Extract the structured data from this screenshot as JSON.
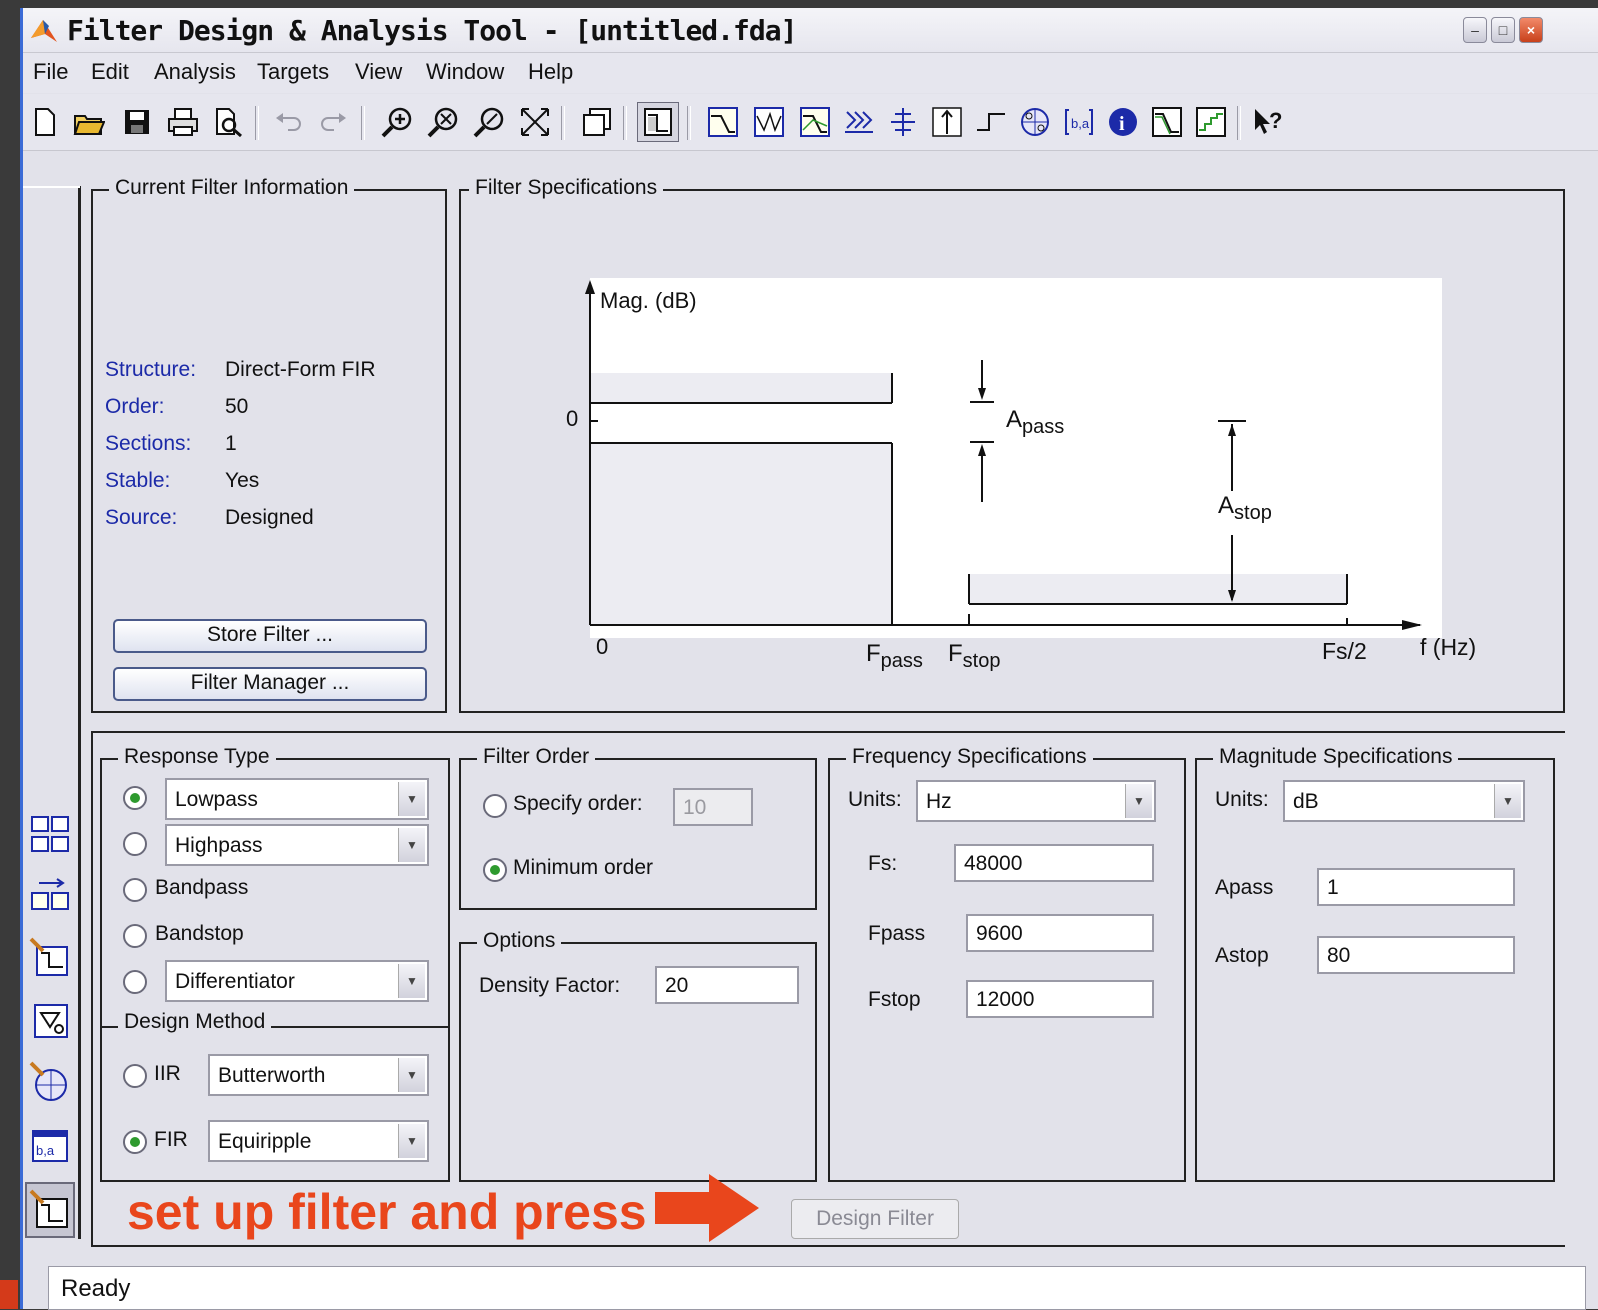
{
  "window": {
    "title": "Filter Design & Analysis Tool - [untitled.fda]",
    "minimize_label": "–",
    "maximize_label": "□",
    "close_label": "×"
  },
  "menu": [
    "File",
    "Edit",
    "Analysis",
    "Targets",
    "View",
    "Window",
    "Help"
  ],
  "toolbar_icons": [
    "new-file-icon",
    "open-folder-icon",
    "save-icon",
    "print-icon",
    "print-preview-icon",
    "undo-icon",
    "redo-icon",
    "zoom-in-icon",
    "zoom-x-icon",
    "zoom-y-icon",
    "full-view-icon",
    "new-window-icon",
    "filter-specs-icon",
    "magnitude-response-icon",
    "phase-response-icon",
    "magnitude-phase-icon",
    "group-delay-icon",
    "phase-delay-icon",
    "impulse-response-icon",
    "step-response-icon",
    "pole-zero-icon",
    "coefficients-icon",
    "info-icon",
    "magnitude-estimate-icon",
    "round-off-noise-icon",
    "whats-this-help-icon"
  ],
  "sidebar_icons": [
    "transform-filter-icon",
    "convert-structure-icon",
    "import-filter-icon",
    "realize-model-icon",
    "pole-zero-editor-icon",
    "quantize-icon",
    "design-filter-icon"
  ],
  "current_filter": {
    "title": "Current Filter Information",
    "rows": [
      {
        "label": "Structure:",
        "value": "Direct-Form FIR"
      },
      {
        "label": "Order:",
        "value": "50"
      },
      {
        "label": "Sections:",
        "value": "1"
      },
      {
        "label": "Stable:",
        "value": "Yes"
      },
      {
        "label": "Source:",
        "value": "Designed"
      }
    ],
    "store_button": "Store Filter ...",
    "manager_button": "Filter Manager ..."
  },
  "filter_specs": {
    "title": "Filter Specifications",
    "y_label": "Mag. (dB)",
    "zero_y": "0",
    "zero_x": "0",
    "fpass_main": "F",
    "fpass_sub": "pass",
    "fstop_main": "F",
    "fstop_sub": "stop",
    "fs2": "Fs/2",
    "x_label": "f (Hz)",
    "apass_main": "A",
    "apass_sub": "pass",
    "astop_main": "A",
    "astop_sub": "stop"
  },
  "response_type": {
    "title": "Response Type",
    "options": [
      {
        "label": "Lowpass",
        "checked": true,
        "dropdown": true
      },
      {
        "label": "Highpass",
        "checked": false,
        "dropdown": true
      },
      {
        "label": "Bandpass",
        "checked": false,
        "dropdown": false
      },
      {
        "label": "Bandstop",
        "checked": false,
        "dropdown": false
      },
      {
        "label": "Differentiator",
        "checked": false,
        "dropdown": true
      }
    ]
  },
  "design_method": {
    "title": "Design Method",
    "iir_label": "IIR",
    "iir_value": "Butterworth",
    "fir_label": "FIR",
    "fir_value": "Equiripple",
    "selected": "FIR"
  },
  "filter_order": {
    "title": "Filter Order",
    "specify_label": "Specify order:",
    "specify_value": "10",
    "minimum_label": "Minimum order",
    "selected": "minimum"
  },
  "options": {
    "title": "Options",
    "density_label": "Density Factor:",
    "density_value": "20"
  },
  "frequency_specs": {
    "title": "Frequency Specifications",
    "units_label": "Units:",
    "units_value": "Hz",
    "fs_label": "Fs:",
    "fs_value": "48000",
    "fpass_label": "Fpass",
    "fpass_value": "9600",
    "fstop_label": "Fstop",
    "fstop_value": "12000"
  },
  "magnitude_specs": {
    "title": "Magnitude Specifications",
    "units_label": "Units:",
    "units_value": "dB",
    "apass_label": "Apass",
    "apass_value": "1",
    "astop_label": "Astop",
    "astop_value": "80"
  },
  "annotation": "set up filter and press",
  "design_button": "Design Filter",
  "status": "Ready",
  "colors": {
    "accent_red": "#e9461c",
    "info_label": "#1c2aa8",
    "radio_checked": "#2e9a2e"
  }
}
